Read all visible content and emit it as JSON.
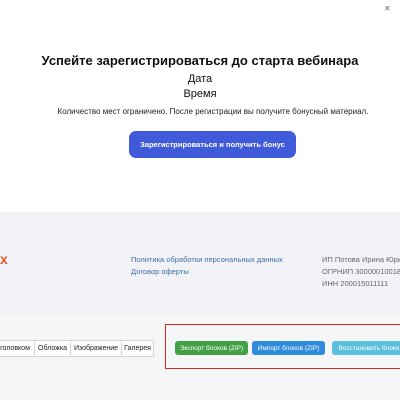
{
  "webinar": {
    "corner_mark": "✕",
    "title": "Успейте зарегистрироваться до старта вебинара",
    "date_label": "Дата",
    "time_label": "Время",
    "note": "Количество мест ограничено. После регистрации вы получите бонусный материал.",
    "register_button": "Зарегистрироваться и получить бонус"
  },
  "footer": {
    "logo_fragment": "x",
    "links": [
      "Политика обработки персональных данных",
      "Договор оферты"
    ],
    "requisites": [
      "ИП Потова Ирина Юрь",
      "ОГРНИП 30000010018",
      "ИНН 200015011111"
    ]
  },
  "editor": {
    "tabs": [
      "головком",
      "Обложка",
      "Изображение",
      "Галерея"
    ],
    "buttons": {
      "export": "Экспорт блоков (ZIP)",
      "import": "Импорт блоков (ZIP)",
      "restore": "Восстановить блоки"
    }
  },
  "colors": {
    "primary_button": "#3f5bd9",
    "export_button": "#43a047",
    "import_button": "#2f8bdb",
    "restore_button": "#5bc0de",
    "highlight_border": "#dd2222",
    "logo_accent": "#e4562a"
  }
}
